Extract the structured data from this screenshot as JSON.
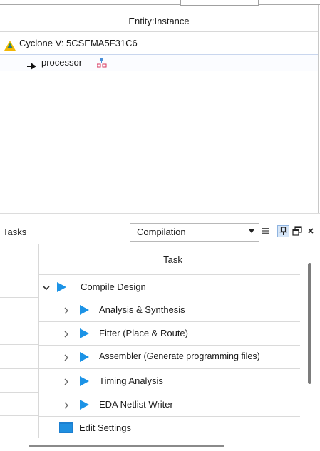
{
  "hierarchy": {
    "column_header": "Entity:Instance",
    "device_label": "Cyclone V: 5CSEMA5F31C6",
    "instance_label": "processor"
  },
  "tasks": {
    "title": "Tasks",
    "flow_select_value": "Compilation",
    "column_header": "Task",
    "items": [
      {
        "label": "Compile Design",
        "expanded": true,
        "level": 0
      },
      {
        "label": "Analysis & Synthesis",
        "expanded": false,
        "level": 1
      },
      {
        "label": "Fitter (Place & Route)",
        "expanded": false,
        "level": 1
      },
      {
        "label": "Assembler (Generate programming files)",
        "expanded": false,
        "level": 1
      },
      {
        "label": "Timing Analysis",
        "expanded": false,
        "level": 1
      },
      {
        "label": "EDA Netlist Writer",
        "expanded": false,
        "level": 1
      },
      {
        "label": "Edit Settings",
        "level": 1
      }
    ],
    "toolbar_icons": [
      "dropdown-arrow-icon",
      "list-icon",
      "pin-icon",
      "float-window-icon",
      "close-icon"
    ]
  },
  "colors": {
    "play_blue": "#1c93e6",
    "device_icon_yellow": "#f2b705",
    "selection_border": "#c9d6ee"
  }
}
